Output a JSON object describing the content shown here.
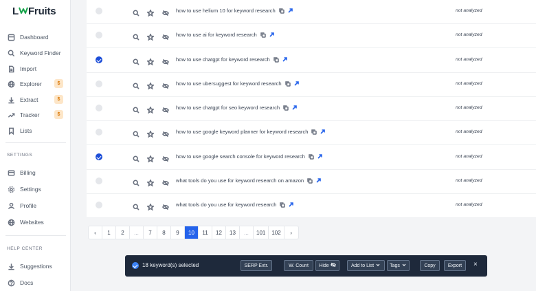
{
  "brand": {
    "logo_pre": "L",
    "logo_post": "Fruits"
  },
  "sidebar": {
    "items": [
      {
        "label": "Dashboard",
        "icon": "dashboard-icon"
      },
      {
        "label": "Keyword Finder",
        "icon": "search-icon"
      },
      {
        "label": "Import",
        "icon": "file-icon"
      },
      {
        "label": "Explorer",
        "icon": "globe-icon",
        "badge": "$"
      },
      {
        "label": "Extract",
        "icon": "download-icon",
        "badge": "$"
      },
      {
        "label": "Tracker",
        "icon": "trend-icon",
        "badge": "$"
      },
      {
        "label": "Lists",
        "icon": "bookmark-icon"
      }
    ],
    "settings_label": "SETTINGS",
    "settings_items": [
      {
        "label": "Billing",
        "icon": "credit-card-icon"
      },
      {
        "label": "Settings",
        "icon": "gear-icon"
      },
      {
        "label": "Profile",
        "icon": "user-icon"
      },
      {
        "label": "Websites",
        "icon": "globe-icon"
      }
    ],
    "help_label": "HELP CENTER",
    "help_items": [
      {
        "label": "Suggestions",
        "icon": "download-icon"
      },
      {
        "label": "Docs",
        "icon": "question-icon"
      }
    ]
  },
  "rows": [
    {
      "keyword": "how to use helium 10 for keyword research",
      "status": "not analyzed",
      "checked": false
    },
    {
      "keyword": "how to use ai for keyword research",
      "status": "not analyzed",
      "checked": false
    },
    {
      "keyword": "how to use chatgpt for keyword research",
      "status": "not analyzed",
      "checked": true
    },
    {
      "keyword": "how to use ubersuggest for keyword research",
      "status": "not analyzed",
      "checked": false
    },
    {
      "keyword": "how to use chatgpt for seo keyword research",
      "status": "not analyzed",
      "checked": false
    },
    {
      "keyword": "how to use google keyword planner for keyword research",
      "status": "not analyzed",
      "checked": false
    },
    {
      "keyword": "how to use google search console for keyword research",
      "status": "not analyzed",
      "checked": true
    },
    {
      "keyword": "what tools do you use for keyword research on amazon",
      "status": "not analyzed",
      "checked": false
    },
    {
      "keyword": "what tools do you use for keyword research",
      "status": "not analyzed",
      "checked": false
    }
  ],
  "pagination": {
    "prev": "‹",
    "pages": [
      "1",
      "2",
      "...",
      "7",
      "8",
      "9",
      "10",
      "11",
      "12",
      "13",
      "...",
      "101",
      "102"
    ],
    "active": "10",
    "next": "›"
  },
  "selection_bar": {
    "text": "18 keyword(s) selected",
    "serp": "SERP Extr.",
    "wcount": "W. Count",
    "hide": "Hide",
    "add_to_list": "Add to List",
    "tags": "Tags",
    "copy": "Copy",
    "export": "Export",
    "close": "×"
  },
  "colors": {
    "accent": "#2563eb",
    "brand_green": "#16a34a",
    "bar_bg": "#1e293b"
  }
}
